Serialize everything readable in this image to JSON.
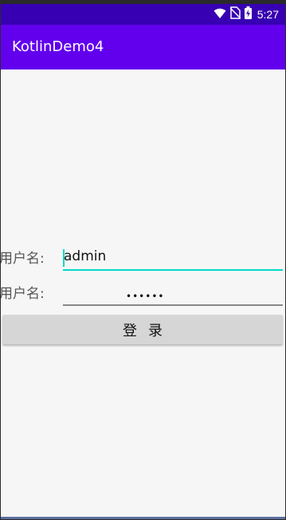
{
  "status_bar": {
    "time": "5:27",
    "icons": [
      "wifi-icon",
      "no-sim-icon",
      "battery-charging-icon"
    ],
    "color": "#3700b3"
  },
  "app_bar": {
    "title": "KotlinDemo4",
    "color": "#6200ee"
  },
  "form": {
    "username_label": "用户名:",
    "username_value": "admin",
    "password_label": "用户名:",
    "password_value": "••••••",
    "focus_color": "#03dac5"
  },
  "login_button": {
    "label": "登录",
    "color": "#d6d6d6"
  }
}
